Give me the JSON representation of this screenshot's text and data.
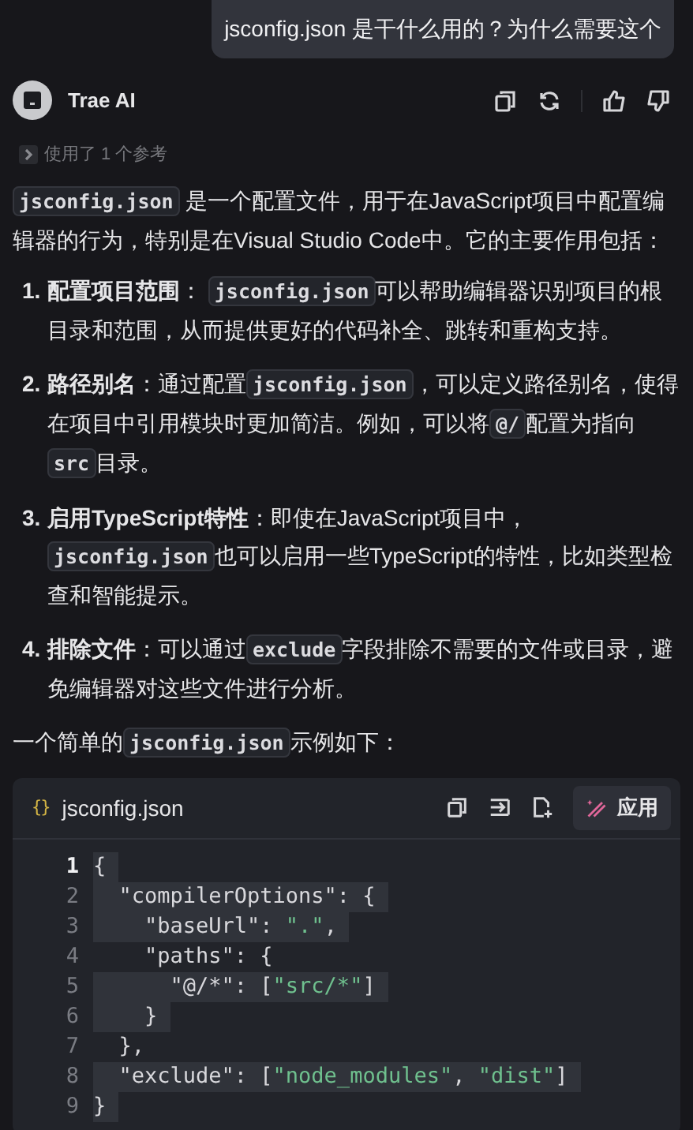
{
  "user_message": {
    "text": "jsconfig.json 是干什么用的？为什么需要这个"
  },
  "assistant": {
    "name": "Trae AI",
    "references": {
      "label": "使用了 1 个参考",
      "expanded": false
    }
  },
  "paragraphs": [
    {
      "kind": "para",
      "segments": [
        {
          "kind": "code",
          "text": "jsconfig.json"
        },
        {
          "kind": "text",
          "text": " 是一个配置文件，用于在JavaScript项目中配置编辑器的行为，特别是在Visual Studio Code中。它的主要作用包括："
        }
      ]
    },
    {
      "kind": "item",
      "number": "1.",
      "segments": [
        {
          "kind": "bold",
          "text": "配置项目范围"
        },
        {
          "kind": "text",
          "text": "： "
        },
        {
          "kind": "code",
          "text": "jsconfig.json"
        },
        {
          "kind": "text",
          "text": "可以帮助编辑器识别项目的根目录和范围，从而提供更好的代码补全、跳转和重构支持。"
        }
      ]
    },
    {
      "kind": "item",
      "number": "2.",
      "segments": [
        {
          "kind": "bold",
          "text": "路径别名"
        },
        {
          "kind": "text",
          "text": "：通过配置"
        },
        {
          "kind": "code",
          "text": "jsconfig.json"
        },
        {
          "kind": "text",
          "text": "，可以定义路径别名，使得在项目中引用模块时更加简洁。例如，可以将"
        },
        {
          "kind": "code",
          "text": "@/"
        },
        {
          "kind": "text",
          "text": "配置为指向"
        },
        {
          "kind": "code",
          "text": "src"
        },
        {
          "kind": "text",
          "text": "目录。"
        }
      ]
    },
    {
      "kind": "item",
      "number": "3.",
      "segments": [
        {
          "kind": "bold",
          "text": "启用TypeScript特性"
        },
        {
          "kind": "text",
          "text": "：即使在JavaScript项目中，"
        },
        {
          "kind": "code",
          "text": "jsconfig.json"
        },
        {
          "kind": "text",
          "text": "也可以启用一些TypeScript的特性，比如类型检查和智能提示。"
        }
      ]
    },
    {
      "kind": "item",
      "number": "4.",
      "segments": [
        {
          "kind": "bold",
          "text": "排除文件"
        },
        {
          "kind": "text",
          "text": "：可以通过"
        },
        {
          "kind": "code",
          "text": "exclude"
        },
        {
          "kind": "text",
          "text": "字段排除不需要的文件或目录，避免编辑器对这些文件进行分析。"
        }
      ]
    },
    {
      "kind": "para",
      "segments": [
        {
          "kind": "text",
          "text": "一个简单的"
        },
        {
          "kind": "code",
          "text": "jsconfig.json"
        },
        {
          "kind": "text",
          "text": "示例如下："
        }
      ]
    }
  ],
  "code_block": {
    "filename": "jsconfig.json",
    "icon_text": "{}",
    "apply_button": "应用",
    "lines": [
      {
        "number": "1",
        "active": true,
        "highlighted": true,
        "tokens": [
          {
            "kind": "punct",
            "text": "{"
          }
        ]
      },
      {
        "number": "2",
        "active": false,
        "highlighted": true,
        "tokens": [
          {
            "kind": "punct",
            "text": "  \"compilerOptions\": {"
          }
        ]
      },
      {
        "number": "3",
        "active": false,
        "highlighted": true,
        "tokens": [
          {
            "kind": "punct",
            "text": "    \"baseUrl\": "
          },
          {
            "kind": "string",
            "text": "\".\""
          },
          {
            "kind": "punct",
            "text": ","
          }
        ]
      },
      {
        "number": "4",
        "active": false,
        "highlighted": false,
        "tokens": [
          {
            "kind": "punct",
            "text": "    \"paths\": {"
          }
        ]
      },
      {
        "number": "5",
        "active": false,
        "highlighted": true,
        "tokens": [
          {
            "kind": "punct",
            "text": "      \"@/*\": ["
          },
          {
            "kind": "string",
            "text": "\"src/*\""
          },
          {
            "kind": "punct",
            "text": "]"
          }
        ]
      },
      {
        "number": "6",
        "active": false,
        "highlighted": true,
        "tokens": [
          {
            "kind": "punct",
            "text": "    }"
          }
        ]
      },
      {
        "number": "7",
        "active": false,
        "highlighted": false,
        "tokens": [
          {
            "kind": "punct",
            "text": "  },"
          }
        ]
      },
      {
        "number": "8",
        "active": false,
        "highlighted": true,
        "tokens": [
          {
            "kind": "punct",
            "text": "  \"exclude\": ["
          },
          {
            "kind": "string",
            "text": "\"node_modules\""
          },
          {
            "kind": "punct",
            "text": ", "
          },
          {
            "kind": "string",
            "text": "\"dist\""
          },
          {
            "kind": "punct",
            "text": "]"
          }
        ]
      },
      {
        "number": "9",
        "active": false,
        "highlighted": true,
        "tokens": [
          {
            "kind": "punct",
            "text": "}"
          }
        ]
      }
    ]
  }
}
